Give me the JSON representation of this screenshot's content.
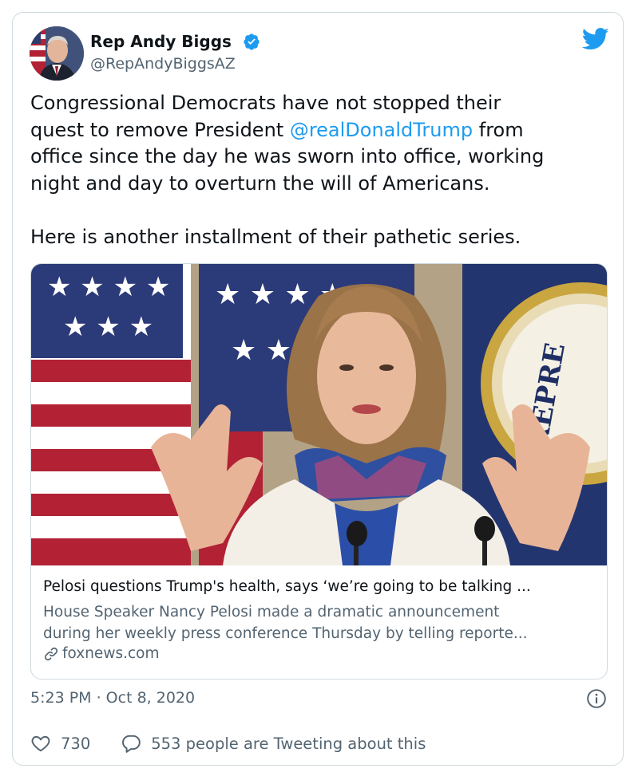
{
  "author": {
    "name": "Rep Andy Biggs",
    "handle": "@RepAndyBiggsAZ",
    "verified": true
  },
  "tweet": {
    "text_before_mention": "Congressional Democrats have not stopped their\nquest to remove President ",
    "mention": "@realDonaldTrump",
    "text_after_mention": " from\noffice since the day he was sworn into office, working\nnight and day to overturn the will of Americans.\n\nHere is another installment of their pathetic series."
  },
  "link_card": {
    "title": "Pelosi questions Trump's health, says ‘we’re going to be talking ...",
    "description": "House Speaker Nancy Pelosi made a dramatic announcement\nduring her weekly press conference Thursday by telling reporte...",
    "domain": "foxnews.com"
  },
  "timestamp": "5:23 PM · Oct 8, 2020",
  "actions": {
    "likes": "730",
    "replies_label": "553 people are Tweeting about this"
  },
  "colors": {
    "accent": "#1d9bf0",
    "secondary_text": "#536471",
    "border": "#cfd9de"
  },
  "icons": [
    "verified-badge-icon",
    "twitter-bird-icon",
    "link-icon",
    "info-icon",
    "heart-icon",
    "reply-bubble-icon"
  ]
}
